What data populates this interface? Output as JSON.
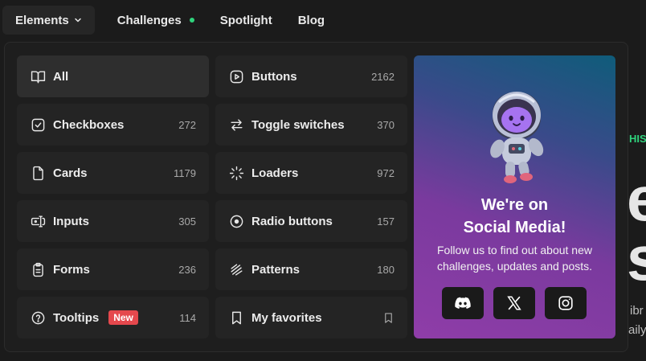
{
  "nav": {
    "elements_label": "Elements",
    "challenges_label": "Challenges",
    "spotlight_label": "Spotlight",
    "blog_label": "Blog",
    "challenges_dot_color": "#2fd37c"
  },
  "menu": {
    "items": [
      {
        "label": "All",
        "count": "",
        "icon": "book-open-icon"
      },
      {
        "label": "Buttons",
        "count": "2162",
        "icon": "play-square-icon"
      },
      {
        "label": "Checkboxes",
        "count": "272",
        "icon": "check-square-icon"
      },
      {
        "label": "Toggle switches",
        "count": "370",
        "icon": "swap-arrows-icon"
      },
      {
        "label": "Cards",
        "count": "1179",
        "icon": "file-icon"
      },
      {
        "label": "Loaders",
        "count": "972",
        "icon": "loader-icon"
      },
      {
        "label": "Inputs",
        "count": "305",
        "icon": "text-cursor-input-icon"
      },
      {
        "label": "Radio buttons",
        "count": "157",
        "icon": "radio-icon"
      },
      {
        "label": "Forms",
        "count": "236",
        "icon": "clipboard-icon"
      },
      {
        "label": "Patterns",
        "count": "180",
        "icon": "pattern-icon"
      },
      {
        "label": "Tooltips",
        "count": "114",
        "badge": "New",
        "icon": "help-circle-icon"
      },
      {
        "label": "My favorites",
        "count": "",
        "icon": "bookmark-icon"
      }
    ]
  },
  "social": {
    "title_line1": "We're on",
    "title_line2": "Social Media!",
    "text": "Follow us to find out about new challenges, updates and posts.",
    "buttons": [
      "discord-icon",
      "x-twitter-icon",
      "instagram-icon"
    ]
  },
  "background": {
    "label_fragment": "HIS",
    "big1": "e",
    "big2": "s",
    "small1": "ibr",
    "small2": "aily"
  },
  "colors": {
    "accent_green": "#2fd37c",
    "badge_red": "#e5484d",
    "panel_bg": "#1e1e1e",
    "item_bg": "#242424"
  }
}
